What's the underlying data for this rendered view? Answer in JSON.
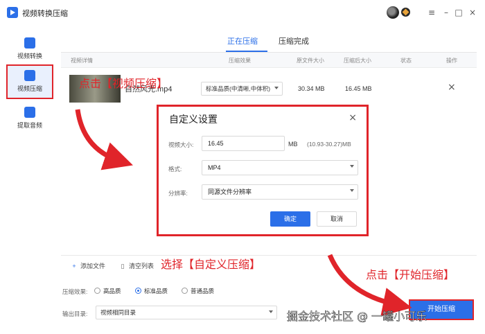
{
  "app": {
    "title": "视频转换压缩",
    "icon": "app-logo-icon"
  },
  "window_controls": {
    "menu": "≡",
    "minimize": "–",
    "maximize": "□",
    "close": "×"
  },
  "sidebar": {
    "items": [
      {
        "label": "视频转换",
        "icon": "video-convert-icon",
        "color": "#2b6fe8"
      },
      {
        "label": "视频压缩",
        "icon": "video-compress-icon",
        "color": "#2b6fe8",
        "active": true
      },
      {
        "label": "提取音频",
        "icon": "extract-audio-icon",
        "color": "#2b6fe8"
      }
    ]
  },
  "tabs": [
    {
      "label": "正在压缩",
      "active": true
    },
    {
      "label": "压缩完成",
      "active": false
    }
  ],
  "table": {
    "headers": [
      "视频详情",
      "压缩效果",
      "原文件大小",
      "压缩后大小",
      "状态",
      "操作"
    ],
    "row": {
      "filename": "自然风光.mp4",
      "effect": "标准品质(中清晰,中体积)",
      "original_size": "30.34 MB",
      "compressed_size": "16.45 MB",
      "close": "×"
    }
  },
  "bottom_bar": {
    "add_file": "添加文件",
    "clear_list": "清空列表"
  },
  "footer": {
    "effect_label": "压缩效果:",
    "options": [
      "高品质",
      "标准品质",
      "普通品质"
    ],
    "selected": "标准品质",
    "output_label": "输出目录:",
    "output_value": "视频相同目录",
    "start_button": "开始压缩"
  },
  "dialog": {
    "title": "自定义设置",
    "close": "×",
    "size_label": "视频大小:",
    "size_value": "16.45",
    "size_unit": "MB",
    "size_range": "(10.93-30.27)MB",
    "format_label": "格式:",
    "format_value": "MP4",
    "resolution_label": "分辨率:",
    "resolution_value": "同源文件分辨率",
    "ok": "确定",
    "cancel": "取消"
  },
  "annotations": {
    "click_compress": "点击【视频压缩】",
    "choose_custom": "选择【自定义压缩】",
    "click_start": "点击【开始压缩】",
    "color": "#e0242a"
  },
  "watermark": "掘金技术社区 @ 一罐小可乐"
}
